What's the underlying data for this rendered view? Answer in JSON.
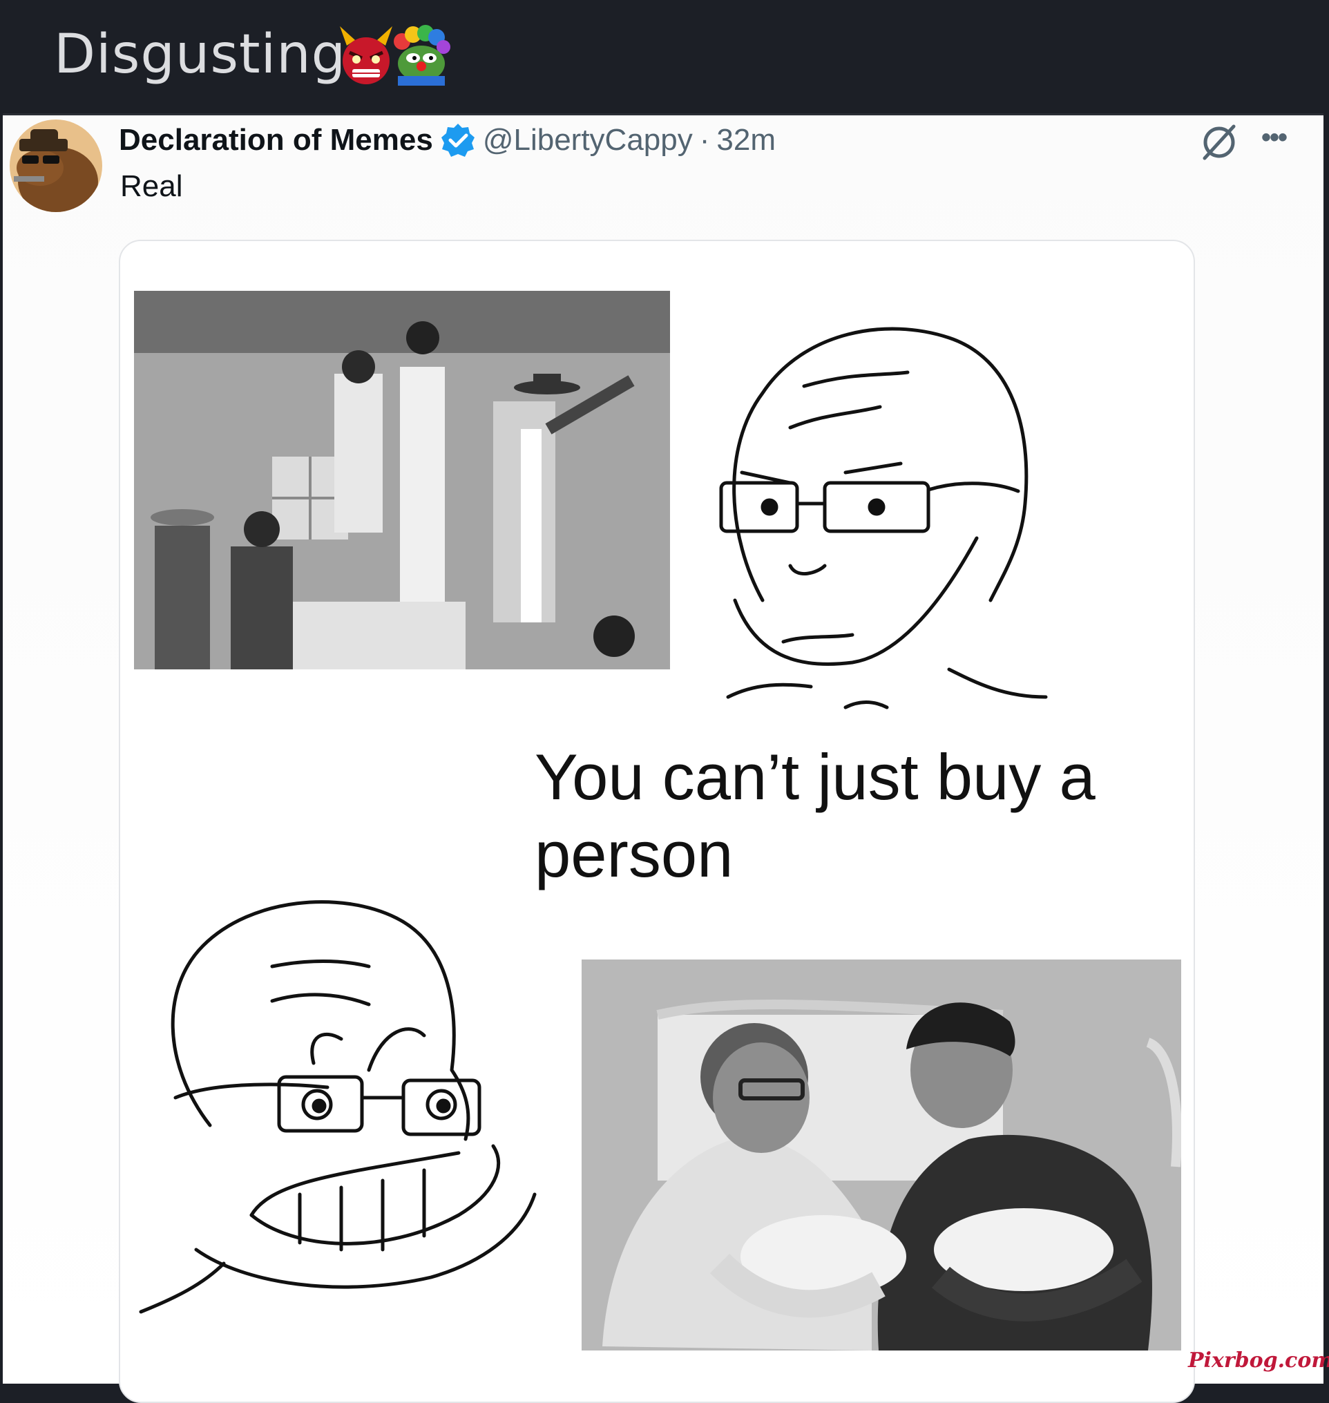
{
  "post": {
    "title": "Disgusting",
    "emojis": [
      "demon-emoji",
      "clown-pepe-emoji"
    ]
  },
  "tweet": {
    "display_name": "Declaration of Memes",
    "verified": true,
    "handle": "@LibertyCappy",
    "separator": "·",
    "time": "32m",
    "text": "Real"
  },
  "meme": {
    "caption": "You can’t just buy a person"
  },
  "watermark": "Pixrbog.com",
  "colors": {
    "topbar_bg": "#1c1f26",
    "verified_blue": "#1d9bf0",
    "watermark_red": "#c0183a"
  }
}
